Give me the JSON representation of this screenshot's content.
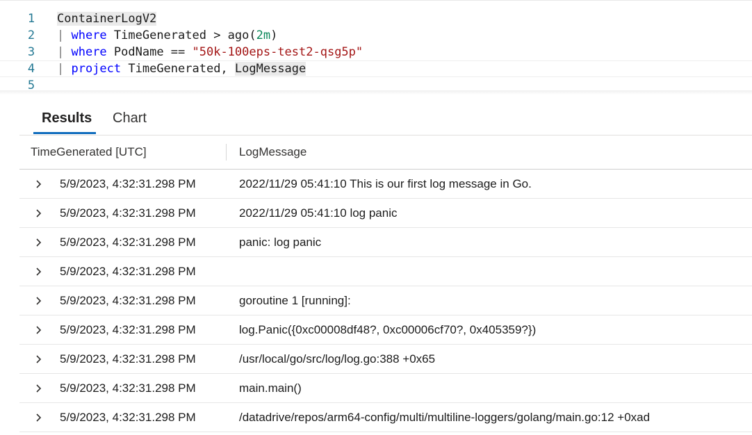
{
  "editor": {
    "lines": [
      {
        "number": "1",
        "parts": [
          {
            "text": "ContainerLogV2",
            "cls": "id hl"
          }
        ]
      },
      {
        "number": "2",
        "parts": [
          {
            "text": "| ",
            "cls": "pipe"
          },
          {
            "text": "where",
            "cls": "kw"
          },
          {
            "text": " TimeGenerated > ago(",
            "cls": "id"
          },
          {
            "text": "2m",
            "cls": "num"
          },
          {
            "text": ")",
            "cls": "id"
          }
        ]
      },
      {
        "number": "3",
        "parts": [
          {
            "text": "| ",
            "cls": "pipe"
          },
          {
            "text": "where",
            "cls": "kw"
          },
          {
            "text": " PodName == ",
            "cls": "id"
          },
          {
            "text": "\"50k-100eps-test2-qsg5p\"",
            "cls": "str"
          }
        ]
      },
      {
        "number": "4",
        "parts": [
          {
            "text": "| ",
            "cls": "pipe"
          },
          {
            "text": "project",
            "cls": "kw"
          },
          {
            "text": " TimeGenerated, ",
            "cls": "id"
          },
          {
            "text": "LogMessage",
            "cls": "id hl"
          }
        ]
      },
      {
        "number": "5",
        "parts": []
      }
    ]
  },
  "tabs": {
    "results": "Results",
    "chart": "Chart"
  },
  "table": {
    "columns": {
      "time": "TimeGenerated [UTC]",
      "message": "LogMessage"
    },
    "rows": [
      {
        "time": "5/9/2023, 4:32:31.298 PM",
        "message": "2022/11/29 05:41:10 This is our first log message in Go."
      },
      {
        "time": "5/9/2023, 4:32:31.298 PM",
        "message": "2022/11/29 05:41:10 log panic"
      },
      {
        "time": "5/9/2023, 4:32:31.298 PM",
        "message": "panic: log panic"
      },
      {
        "time": "5/9/2023, 4:32:31.298 PM",
        "message": ""
      },
      {
        "time": "5/9/2023, 4:32:31.298 PM",
        "message": "goroutine 1 [running]:"
      },
      {
        "time": "5/9/2023, 4:32:31.298 PM",
        "message": "log.Panic({0xc00008df48?, 0xc00006cf70?, 0x405359?})"
      },
      {
        "time": "5/9/2023, 4:32:31.298 PM",
        "message": "/usr/local/go/src/log/log.go:388 +0x65"
      },
      {
        "time": "5/9/2023, 4:32:31.298 PM",
        "message": "main.main()"
      },
      {
        "time": "5/9/2023, 4:32:31.298 PM",
        "message": "/datadrive/repos/arm64-config/multi/multiline-loggers/golang/main.go:12 +0xad"
      }
    ]
  }
}
